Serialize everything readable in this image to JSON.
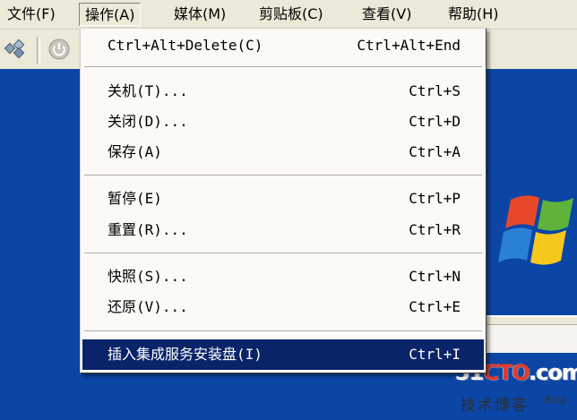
{
  "menubar": {
    "items": [
      {
        "label": "文件(F)"
      },
      {
        "label": "操作(A)"
      },
      {
        "label": "媒体(M)"
      },
      {
        "label": "剪贴板(C)"
      },
      {
        "label": "查看(V)"
      },
      {
        "label": "帮助(H)"
      }
    ]
  },
  "toolbar": {
    "icons": [
      "network-icon",
      "power-icon"
    ]
  },
  "dropdown": {
    "items": [
      {
        "label": "Ctrl+Alt+Delete(C)",
        "shortcut": "Ctrl+Alt+End"
      },
      {
        "label": "关机(T)...",
        "shortcut": "Ctrl+S"
      },
      {
        "label": "关闭(D)...",
        "shortcut": "Ctrl+D"
      },
      {
        "label": "保存(A)",
        "shortcut": "Ctrl+A"
      },
      {
        "label": "暂停(E)",
        "shortcut": "Ctrl+P"
      },
      {
        "label": "重置(R)...",
        "shortcut": "Ctrl+R"
      },
      {
        "label": "快照(S)...",
        "shortcut": "Ctrl+N"
      },
      {
        "label": "还原(V)...",
        "shortcut": "Ctrl+E"
      },
      {
        "label": "插入集成服务安装盘(I)",
        "shortcut": "Ctrl+I"
      }
    ]
  },
  "watermark": {
    "brand_part1": "51",
    "brand_part2": "CTO",
    "brand_part3": ".com",
    "tagline": "技术博客",
    "blog": "Blog"
  },
  "colors": {
    "desktop": "#0b45a6",
    "highlight": "#0a246a",
    "menu_bg": "#ece9d8"
  }
}
